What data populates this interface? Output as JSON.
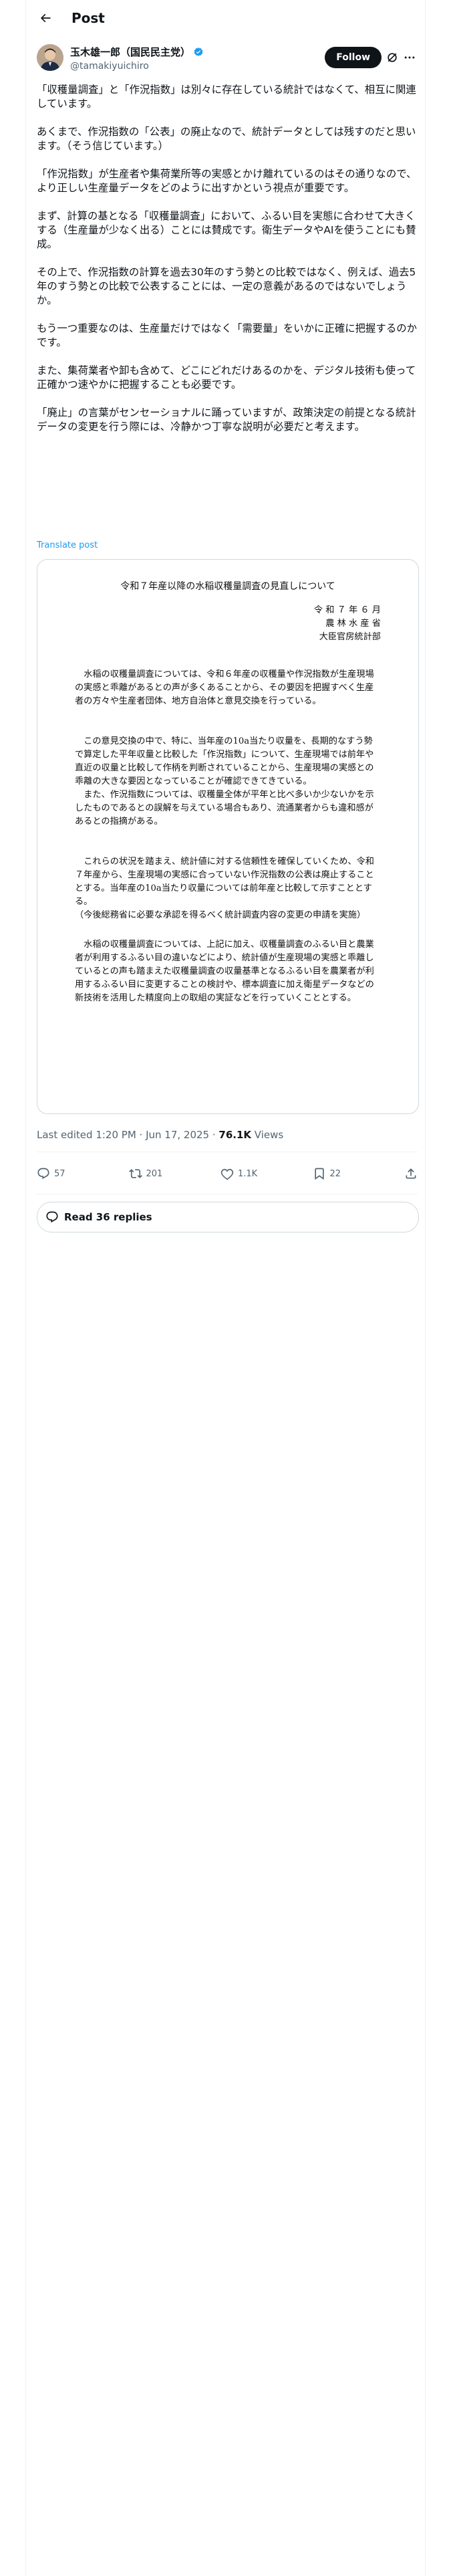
{
  "header": {
    "title": "Post"
  },
  "author": {
    "name": "玉木雄一郎（国民民主党）",
    "handle": "@tamakiyuichiro",
    "follow_label": "Follow"
  },
  "post": {
    "paragraphs": [
      "「収穫量調査」と「作況指数」は別々に存在している統計ではなくて、相互に関連しています。",
      "あくまで、作況指数の「公表」の廃止なので、統計データとしては残すのだと思います。（そう信じています。）",
      "「作況指数」が生産者や集荷業所等の実感とかけ離れているのはその通りなので、より正しい生産量データをどのように出すかという視点が重要です。",
      "まず、計算の基となる「収穫量調査」において、ふるい目を実態に合わせて大きくする（生産量が少なく出る）ことには賛成です。衛生データやAIを使うことにも賛成。",
      "その上で、作況指数の計算を過去30年のすう勢との比較ではなく、例えば、過去5年のすう勢との比較で公表することには、一定の意義があるのではないでしょうか。",
      "もう一つ重要なのは、生産量だけではなく「需要量」をいかに正確に把握するのかです。",
      "また、集荷業者や卸も含めて、どこにどれだけあるのかを、デジタル技術も使って正確かつ速やかに把握することも必要です。",
      "「廃止」の言葉がセンセーショナルに踊っていますが、政策決定の前提となる統計データの変更を行う際には、冷静かつ丁寧な説明が必要だと考えます。"
    ],
    "translate_label": "Translate post"
  },
  "document": {
    "title": "令和７年産以降の水稲収穫量調査の見直しについて",
    "date": "令 和 ７ 年 ６ 月",
    "ministry": "農 林 水 産 省",
    "department": "大臣官房統計部",
    "para1": "水稲の収穫量調査については、令和６年産の収穫量や作況指数が生産現場の実感と乖離があるとの声が多くあることから、その要因を把握すべく生産者の方々や生産者団体、地方自治体と意見交換を行っている。",
    "para2": "この意見交換の中で、特に、当年産の10a当たり収量を、長期的なすう勢で算定した平年収量と比較した「作況指数」について、生産現場では前年や直近の収量と比較して作柄を判断されていることから、生産現場の実感との乖離の大きな要因となっていることが確認できてきている。",
    "para3": "また、作況指数については、収穫量全体が平年と比べ多いか少ないかを示したものであるとの誤解を与えている場合もあり、流通業者からも違和感があるとの指摘がある。",
    "para4": "これらの状況を踏まえ、統計値に対する信頼性を確保していくため、令和７年産から、生産現場の実感に合っていない作況指数の公表は廃止することとする。当年産の10a当たり収量については前年産と比較して示すこととする。",
    "para4_note": "（今後総務省に必要な承認を得るべく統計調査内容の変更の申請を実施）",
    "para5": "水稲の収穫量調査については、上記に加え、収穫量調査のふるい目と農業者が利用するふるい目の違いなどにより、統計値が生産現場の実感と乖離しているとの声も踏まえた収穫量調査の収量基準となるふるい目を農業者が利用するふるい目に変更することの検討や、標本調査に加え衛星データなどの新技術を活用した精度向上の取組の実証などを行っていくこととする。"
  },
  "meta": {
    "time": "Last edited 1:20 PM · Jun 17, 2025 · ",
    "views_count": "76.1K",
    "views_label": " Views"
  },
  "actions": {
    "replies": "57",
    "reposts": "201",
    "likes": "1.1K",
    "bookmarks": "22"
  },
  "replies_button": {
    "label": "Read 36 replies"
  },
  "colors": {
    "accent": "#1d9bf0",
    "text": "#0f1419",
    "muted": "#536471",
    "border": "#cfd9de"
  }
}
